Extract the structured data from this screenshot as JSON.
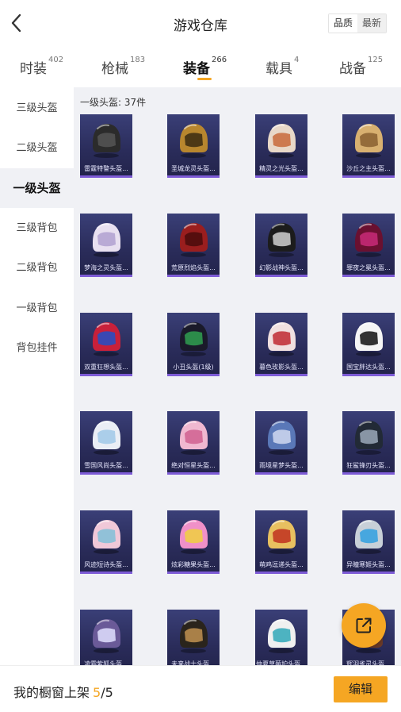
{
  "header": {
    "title": "游戏仓库",
    "sort_options": [
      "品质",
      "最新"
    ]
  },
  "tabs": [
    {
      "label": "时装",
      "count": "402"
    },
    {
      "label": "枪械",
      "count": "183"
    },
    {
      "label": "装备",
      "count": "266",
      "active": true
    },
    {
      "label": "载具",
      "count": "4"
    },
    {
      "label": "战备",
      "count": "125"
    }
  ],
  "sidebar": {
    "items": [
      {
        "label": "三级头盔"
      },
      {
        "label": "二级头盔"
      },
      {
        "label": "一级头盔",
        "active": true
      },
      {
        "label": "三级背包"
      },
      {
        "label": "二级背包"
      },
      {
        "label": "一级背包"
      },
      {
        "label": "背包挂件"
      }
    ]
  },
  "content": {
    "count_label": "一级头盔: 37件",
    "items": [
      {
        "name": "雷霆特警头盔...",
        "color": "#2b2b2b",
        "accent": "#555555"
      },
      {
        "name": "圣城龙灵头盔...",
        "color": "#b8862e",
        "accent": "#3a2a10"
      },
      {
        "name": "精灵之光头盔...",
        "color": "#e8d8c8",
        "accent": "#c86a3a"
      },
      {
        "name": "沙丘之主头盔...",
        "color": "#d8b070",
        "accent": "#8a6030"
      },
      {
        "name": "梦海之灵头盔...",
        "color": "#e8e0f0",
        "accent": "#b0a0d0"
      },
      {
        "name": "荒原烈焰头盔...",
        "color": "#9a1e1e",
        "accent": "#4a0c0c"
      },
      {
        "name": "幻影战神头盔...",
        "color": "#1c1c1c",
        "accent": "#d0d0d0"
      },
      {
        "name": "罪夜之冕头盔...",
        "color": "#6a1030",
        "accent": "#c82a78"
      },
      {
        "name": "双重狂想头盔...",
        "color": "#c8203a",
        "accent": "#2050c8"
      },
      {
        "name": "小丑头盔(1级)",
        "color": "#1a1a2a",
        "accent": "#30a050"
      },
      {
        "name": "暮色玫影头盔...",
        "color": "#f0e0e0",
        "accent": "#c02830"
      },
      {
        "name": "国宝胖达头盔...",
        "color": "#f5f5f5",
        "accent": "#111111"
      },
      {
        "name": "雪国风尚头盔...",
        "color": "#eaeef5",
        "accent": "#a0c8e8"
      },
      {
        "name": "绝对恒星头盔...",
        "color": "#f0b8d0",
        "accent": "#d06090"
      },
      {
        "name": "雨境星梦头盔...",
        "color": "#5a78b8",
        "accent": "#d0d8f0"
      },
      {
        "name": "狂鲨锋刃头盔...",
        "color": "#222a36",
        "accent": "#9aa8b8"
      },
      {
        "name": "风迹短诗头盔...",
        "color": "#f0c8d8",
        "accent": "#80c0d8"
      },
      {
        "name": "炫彩糖果头盔...",
        "color": "#f090c8",
        "accent": "#f0d040"
      },
      {
        "name": "萌鸡逗递头盔...",
        "color": "#e8c060",
        "accent": "#c03020"
      },
      {
        "name": "异瞳寒姬头盔...",
        "color": "#c8d0d8",
        "accent": "#30a0e0"
      },
      {
        "name": "凌霜紫狐头盔...",
        "color": "#6a5a98",
        "accent": "#e0e0ff"
      },
      {
        "name": "未来战士头盔...",
        "color": "#2a241c",
        "accent": "#c09050"
      },
      {
        "name": "仲夏草莓护头盔...",
        "color": "#f0f0f0",
        "accent": "#30a8b8"
      },
      {
        "name": "辉羽雀灵头盔...",
        "color": "#6a3a28",
        "accent": "#e0a060"
      }
    ]
  },
  "bottom_bar": {
    "showcase_label": "我的橱窗上架",
    "showcase_current": "5",
    "showcase_total": "/5",
    "edit_label": "编辑"
  },
  "colors": {
    "accent": "#f5a623",
    "card_bg": "#2a2c5a",
    "card_border": "#7d5bd6",
    "panel_bg": "#f0f1f5"
  }
}
